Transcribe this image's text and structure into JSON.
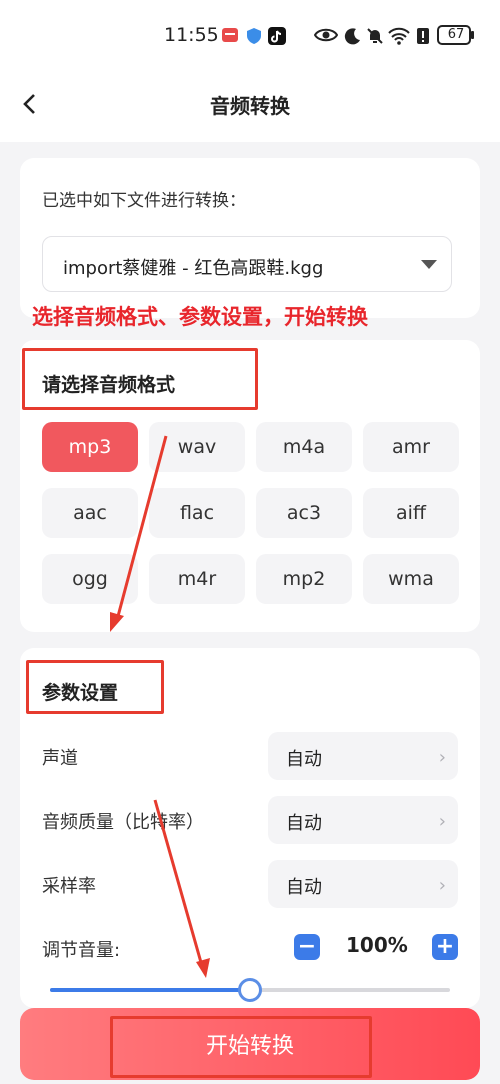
{
  "status": {
    "time": "11:55",
    "battery": "67"
  },
  "header": {
    "title": "音频转换",
    "back_icon": "chevron-left-icon"
  },
  "file_card": {
    "label": "已选中如下文件进行转换：",
    "selected_file": "import蔡健雅 - 红色高跟鞋.kgg"
  },
  "annotation": {
    "text": "选择音频格式、参数设置，开始转换",
    "color": "#e8262c"
  },
  "format_card": {
    "title": "请选择音频格式",
    "formats": [
      "mp3",
      "wav",
      "m4a",
      "amr",
      "aac",
      "flac",
      "ac3",
      "aiff",
      "ogg",
      "m4r",
      "mp2",
      "wma"
    ],
    "selected": "mp3",
    "accent": "#f1585e"
  },
  "params_card": {
    "title": "参数设置",
    "rows": [
      {
        "label": "声道",
        "value": "自动"
      },
      {
        "label": "音频质量（比特率）",
        "value": "自动"
      },
      {
        "label": "采样率",
        "value": "自动"
      }
    ],
    "volume_label": "调节音量:",
    "volume_value": "100%",
    "minus": "−",
    "plus": "+",
    "volume_level_fraction": 0.5,
    "accent": "#3c7be8"
  },
  "start_button": {
    "label": "开始转换"
  }
}
